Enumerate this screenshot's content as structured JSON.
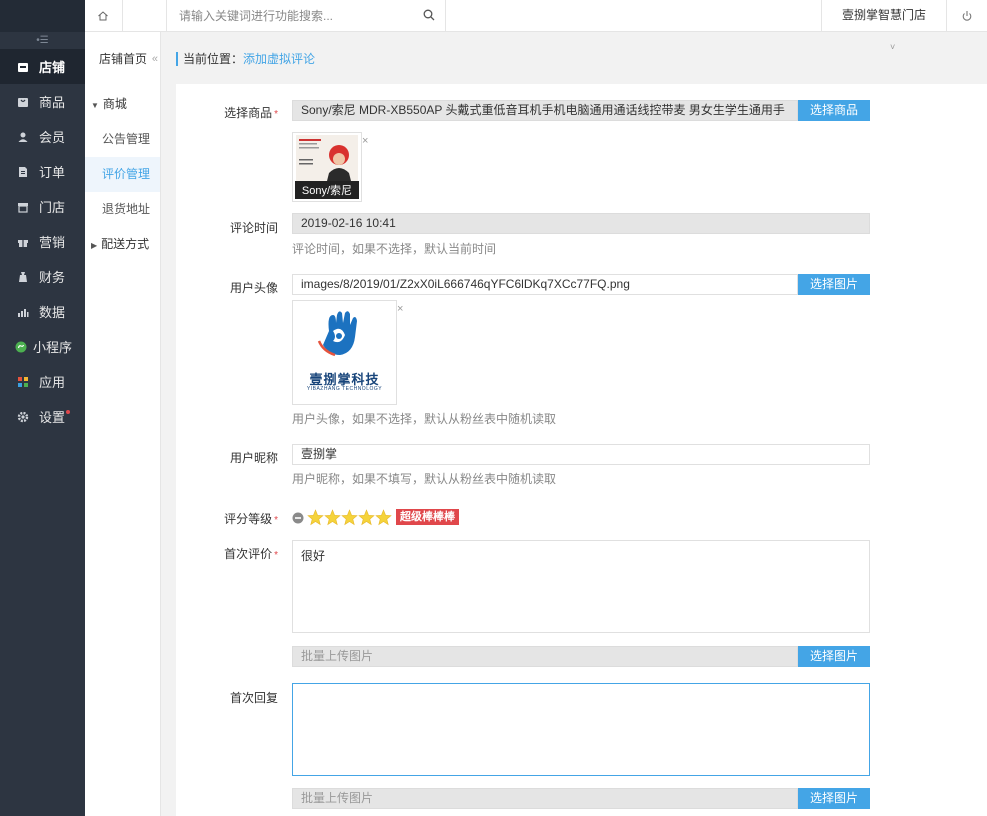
{
  "sidebar": {
    "items": [
      {
        "icon": "store-icon",
        "label": "店铺"
      },
      {
        "icon": "goods-icon",
        "label": "商品"
      },
      {
        "icon": "member-icon",
        "label": "会员"
      },
      {
        "icon": "order-icon",
        "label": "订单"
      },
      {
        "icon": "shop-icon",
        "label": "门店"
      },
      {
        "icon": "gift-icon",
        "label": "营销"
      },
      {
        "icon": "finance-icon",
        "label": "财务"
      },
      {
        "icon": "chart-icon",
        "label": "数据"
      },
      {
        "icon": "miniprogram-icon",
        "label": "小程序"
      },
      {
        "icon": "apps-icon",
        "label": "应用"
      },
      {
        "icon": "gear-icon",
        "label": "设置"
      }
    ]
  },
  "subnav": {
    "home": "店铺首页",
    "group_mall": "商城",
    "leaf_notice": "公告管理",
    "leaf_review": "评价管理",
    "leaf_return": "退货地址",
    "group_delivery": "配送方式"
  },
  "topbar": {
    "search_placeholder": "请输入关键词进行功能搜索...",
    "store_name": "壹捌掌智慧门店"
  },
  "breadcrumb": {
    "prefix": "当前位置：",
    "current": "添加虚拟评论"
  },
  "form": {
    "product_label": "选择商品",
    "product_value": "Sony/索尼 MDR-XB550AP 头戴式重低音耳机手机电脑通用通话线控带麦 男女生学生通用手",
    "product_button": "选择商品",
    "product_thumb_caption": "Sony/索尼",
    "time_label": "评论时间",
    "time_value": "2019-02-16 10:41",
    "time_help": "评论时间，如果不选择，默认当前时间",
    "avatar_label": "用户头像",
    "avatar_value": "images/8/2019/01/Z2xX0iL666746qYFC6lDKq7XCc77FQ.png",
    "avatar_button": "选择图片",
    "avatar_logo_text": "壹捌掌科技",
    "avatar_logo_sub": "YIBAZHANG TECHNOLOGY",
    "avatar_help": "用户头像，如果不选择，默认从粉丝表中随机读取",
    "nick_label": "用户昵称",
    "nick_value": "壹捌掌",
    "nick_help": "用户昵称，如果不填写，默认从粉丝表中随机读取",
    "rating_label": "评分等级",
    "rating_value": 5,
    "rating_max": 5,
    "rating_badge": "超级棒棒棒",
    "first_review_label": "首次评价",
    "first_review_value": "很好",
    "upload_placeholder": "批量上传图片",
    "upload_button": "选择图片",
    "first_reply_label": "首次回复",
    "first_reply_value": "",
    "upload2_placeholder": "批量上传图片",
    "upload2_button": "选择图片"
  }
}
